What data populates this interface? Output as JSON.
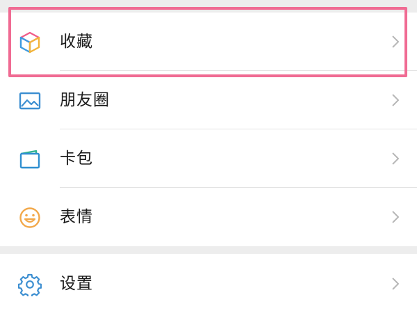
{
  "menu_group_main": {
    "items": [
      {
        "label": "收藏",
        "icon": "favorites-cube-icon"
      },
      {
        "label": "朋友圈",
        "icon": "moments-image-icon"
      },
      {
        "label": "卡包",
        "icon": "card-wallet-icon"
      },
      {
        "label": "表情",
        "icon": "sticker-smiley-icon"
      }
    ]
  },
  "menu_group_settings": {
    "items": [
      {
        "label": "设置",
        "icon": "settings-gear-icon"
      }
    ]
  },
  "colors": {
    "highlight": "#f06b93",
    "page_background": "#ededed",
    "icon_blue": "#3d8fd1",
    "icon_orange": "#f2a84a"
  }
}
